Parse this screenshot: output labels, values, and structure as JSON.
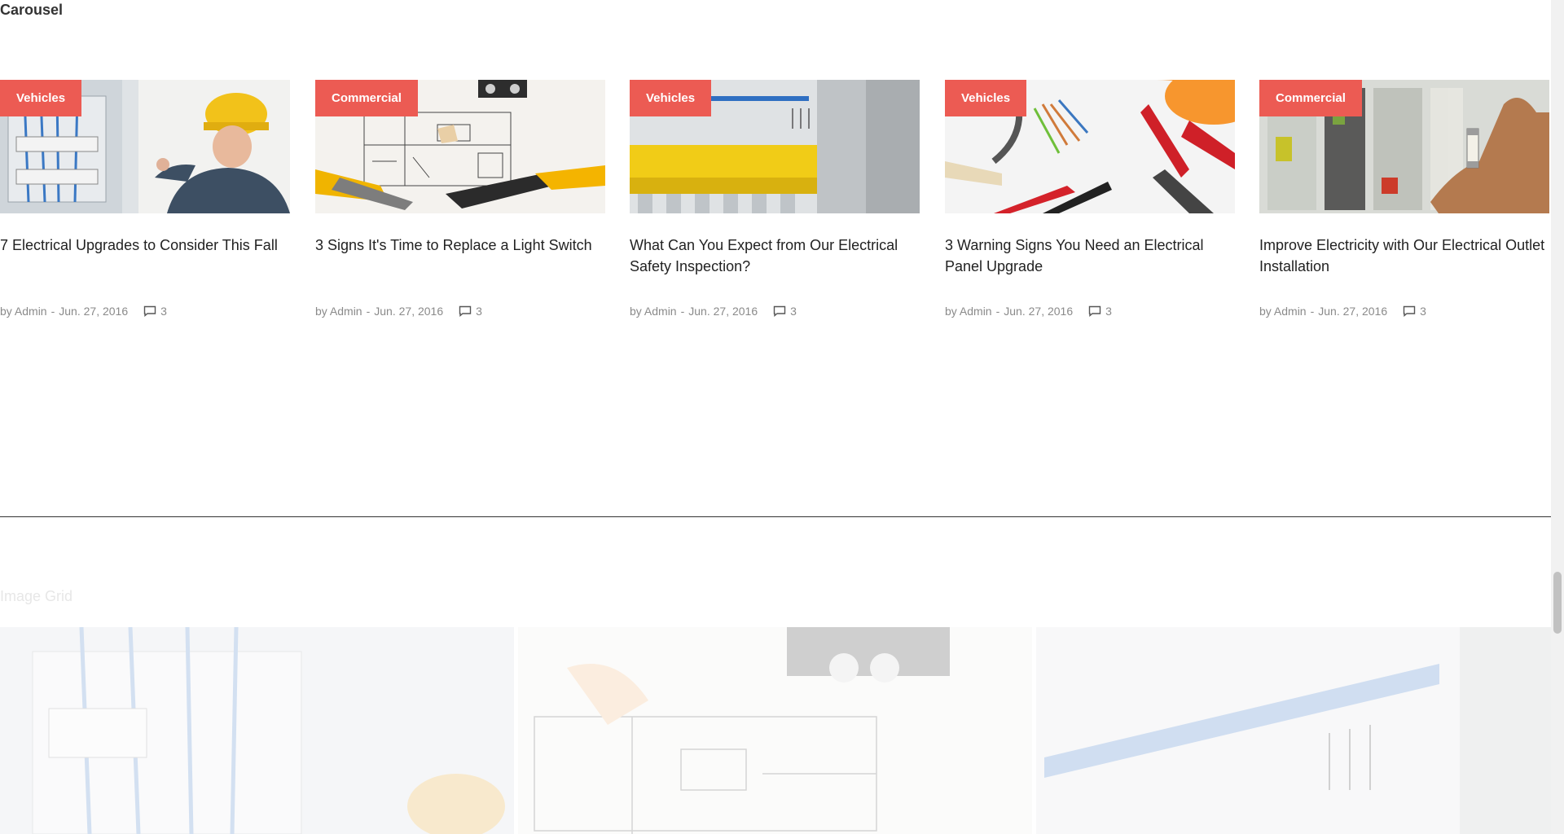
{
  "carousel": {
    "title": "Carousel",
    "cards": [
      {
        "category": "Vehicles",
        "title": "7 Electrical Upgrades to Consider This Fall",
        "author": "by Admin",
        "date": "Jun. 27, 2016",
        "comments": "3"
      },
      {
        "category": "Commercial",
        "title": "3 Signs It's Time to Replace a Light Switch",
        "author": "by Admin",
        "date": "Jun. 27, 2016",
        "comments": "3"
      },
      {
        "category": "Vehicles",
        "title": "What Can You Expect from Our Electrical Safety Inspection?",
        "author": "by Admin",
        "date": "Jun. 27, 2016",
        "comments": "3"
      },
      {
        "category": "Vehicles",
        "title": "3 Warning Signs You Need an Electrical Panel Upgrade",
        "author": "by Admin",
        "date": "Jun. 27, 2016",
        "comments": "3"
      },
      {
        "category": "Commercial",
        "title": "Improve Electricity with Our Electrical Outlet Installation",
        "author": "by Admin",
        "date": "Jun. 27, 2016",
        "comments": "3"
      }
    ]
  },
  "image_grid": {
    "title": "Image Grid"
  },
  "colors": {
    "badge": "#ec5b53",
    "title_text": "#222222",
    "meta_text": "#8a8a8a"
  }
}
